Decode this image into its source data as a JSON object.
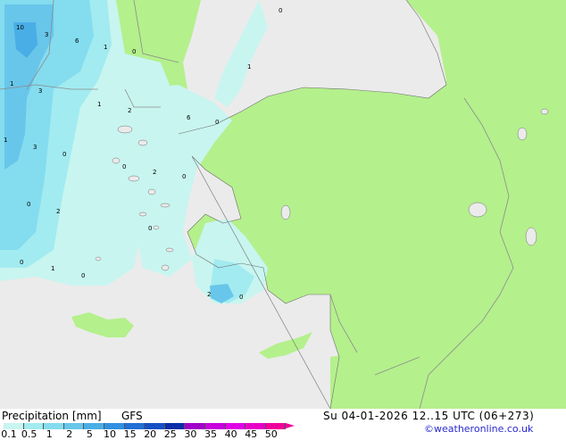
{
  "title": "Precipitation [mm]",
  "model": "GFS",
  "datetime": "Su 04-01-2026 12..15 UTC (06+273)",
  "credit": "©weatheronline.co.uk",
  "legend": {
    "ticks": [
      "0.1",
      "0.5",
      "1",
      "2",
      "5",
      "10",
      "15",
      "20",
      "25",
      "30",
      "35",
      "40",
      "45",
      "50"
    ],
    "colors": [
      "#c8f5f0",
      "#a2ebf0",
      "#84dcef",
      "#68c6ea",
      "#4aaee6",
      "#3190e0",
      "#2070d6",
      "#1450c4",
      "#0a2da8",
      "#a000c8",
      "#c800dc",
      "#e000e6",
      "#e800c8",
      "#f0009a"
    ]
  },
  "map_labels": [
    {
      "value": "10",
      "name": "value-label-10"
    },
    {
      "value": "3",
      "name": "value-label-3"
    },
    {
      "value": "6",
      "name": "value-label-6"
    },
    {
      "value": "1",
      "name": "value-label-1"
    },
    {
      "value": "0",
      "name": "value-label-0"
    }
  ],
  "colors": {
    "sea": "#ebebeb",
    "land": "#b4f08c",
    "border": "#8c8c8c"
  }
}
